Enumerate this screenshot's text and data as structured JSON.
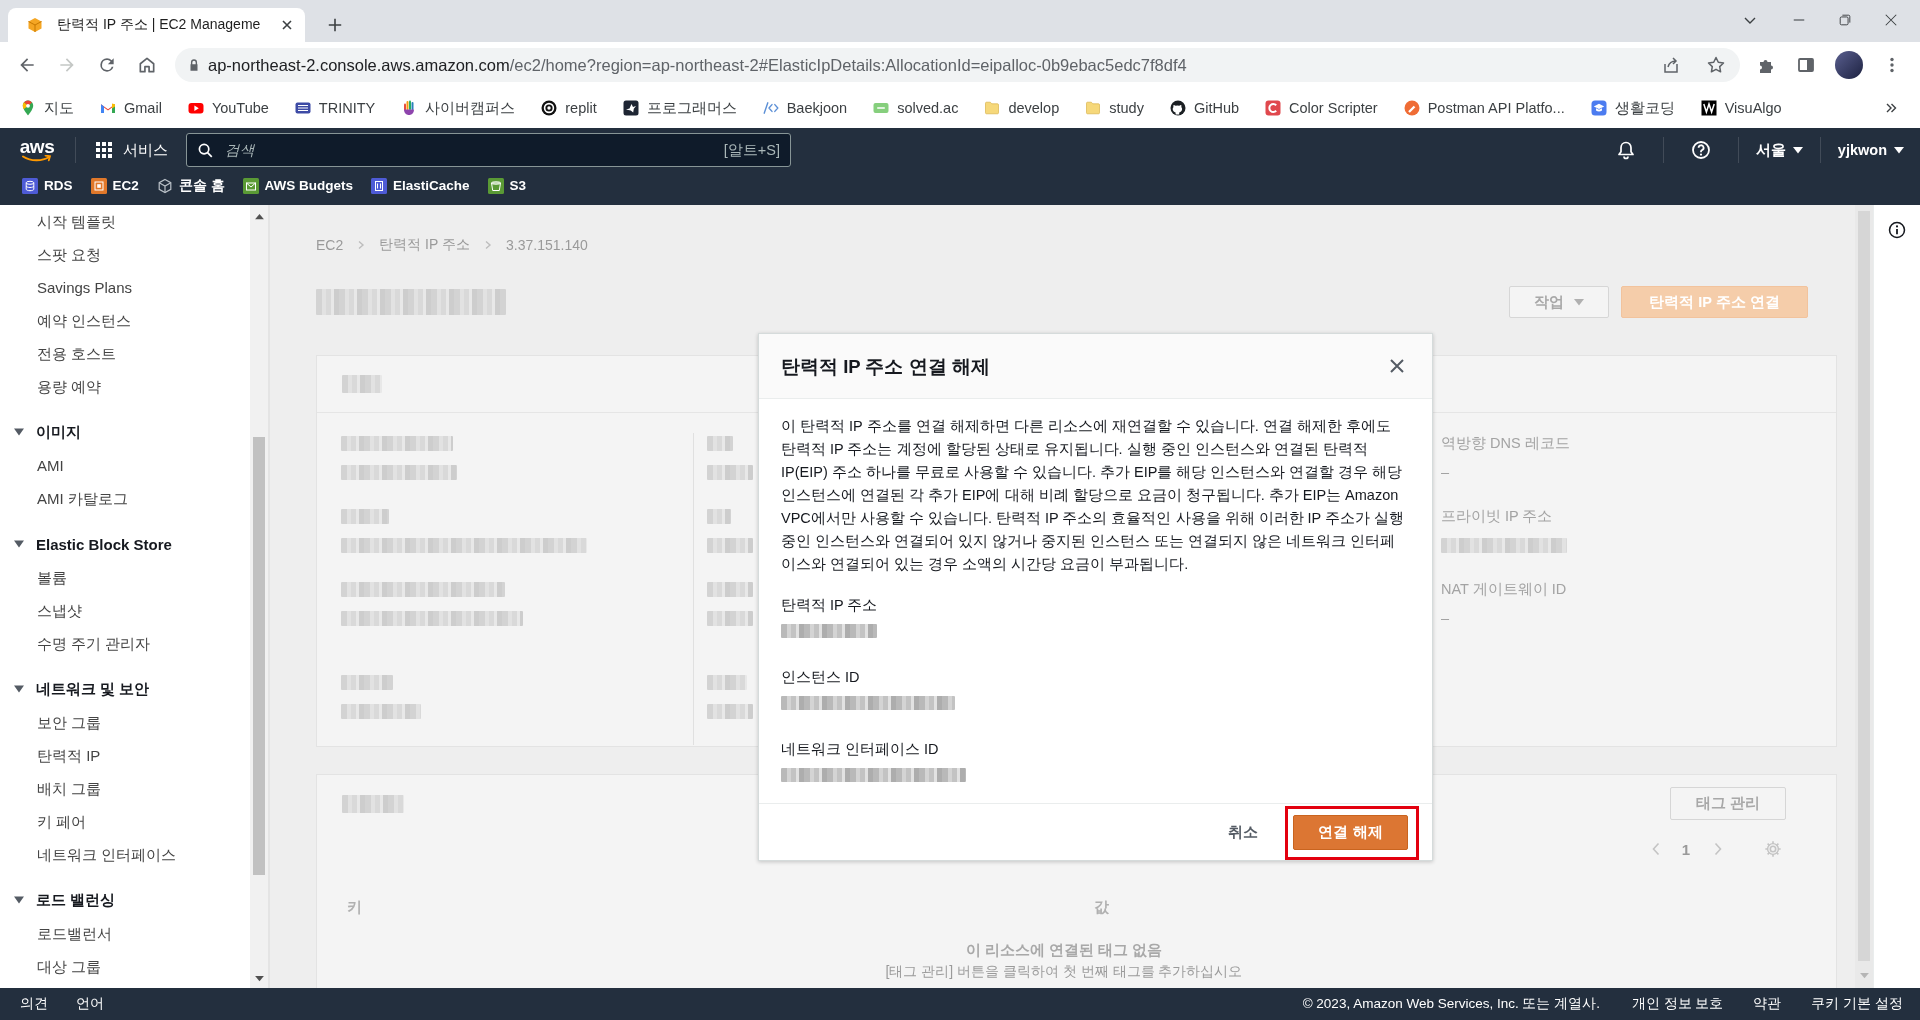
{
  "browser": {
    "tabs": [
      {
        "title": "탄력적 IP 주소 | EC2 Manageme",
        "selected": true
      }
    ],
    "nav_buttons": [
      {
        "kind": "back",
        "disabled": false
      },
      {
        "kind": "forward",
        "disabled": true
      },
      {
        "kind": "reload",
        "disabled": false
      },
      {
        "kind": "home",
        "disabled": false
      }
    ],
    "address": {
      "host": "ap-northeast-2.console.aws.amazon.com",
      "path": "/ec2/home?region=ap-northeast-2#ElasticIpDetails:AllocationId=eipalloc-0b9ebac5edc7f8df4"
    },
    "bookmarks": [
      {
        "label": "지도",
        "kind": "map"
      },
      {
        "label": "Gmail",
        "kind": "mail"
      },
      {
        "label": "YouTube",
        "kind": "video"
      },
      {
        "label": "TRINITY",
        "kind": "building"
      },
      {
        "label": "사이버캠퍼스",
        "kind": "hand"
      },
      {
        "label": "replit",
        "kind": "swirl"
      },
      {
        "label": "프로그래머스",
        "kind": "bird"
      },
      {
        "label": "Baekjoon",
        "kind": "code"
      },
      {
        "label": "solved.ac",
        "kind": "tile"
      },
      {
        "label": "develop",
        "kind": "folder"
      },
      {
        "label": "study",
        "kind": "folder"
      },
      {
        "label": "GitHub",
        "kind": "cat"
      },
      {
        "label": "Color Scripter",
        "kind": "ctile"
      },
      {
        "label": "Postman API Platfo...",
        "kind": "circle"
      },
      {
        "label": "생활코딩",
        "kind": "cap"
      },
      {
        "label": "VisuAlgo",
        "kind": "zigzag"
      }
    ]
  },
  "console_header": {
    "logo": "aws",
    "services": "서비스",
    "search": {
      "placeholder": "검색",
      "shortcut": "[알트+S]"
    },
    "region": "서울",
    "user": "yjkwon",
    "favorites": [
      {
        "label": "RDS",
        "kind": "database"
      },
      {
        "label": "EC2",
        "kind": "chip"
      },
      {
        "label": "콘솔 홈",
        "kind": "cube"
      },
      {
        "label": "AWS Budgets",
        "kind": "envelope"
      },
      {
        "label": "ElastiCache",
        "kind": "memory"
      },
      {
        "label": "S3",
        "kind": "bucket"
      }
    ]
  },
  "sidebar": {
    "items": [
      {
        "label": "시작 템플릿"
      },
      {
        "label": "스팟 요청"
      },
      {
        "label": "Savings Plans"
      },
      {
        "label": "예약 인스턴스"
      },
      {
        "label": "전용 호스트"
      },
      {
        "label": "용량 예약"
      }
    ],
    "sections": [
      {
        "title": "이미지",
        "expanded": true,
        "items": [
          {
            "label": "AMI"
          },
          {
            "label": "AMI 카탈로그"
          }
        ]
      },
      {
        "title": "Elastic Block Store",
        "expanded": true,
        "items": [
          {
            "label": "볼륨"
          },
          {
            "label": "스냅샷"
          },
          {
            "label": "수명 주기 관리자"
          }
        ]
      },
      {
        "title": "네트워크 및 보안",
        "expanded": true,
        "items": [
          {
            "label": "보안 그룹"
          },
          {
            "label": "탄력적 IP"
          },
          {
            "label": "배치 그룹"
          },
          {
            "label": "키 페어"
          },
          {
            "label": "네트워크 인터페이스"
          }
        ]
      },
      {
        "title": "로드 밸런싱",
        "expanded": true,
        "items": [
          {
            "label": "로드밸런서"
          },
          {
            "label": "대상 그룹"
          }
        ]
      }
    ]
  },
  "page": {
    "breadcrumb": [
      "EC2",
      "탄력적 IP 주소",
      "3.37.151.140"
    ],
    "title_pixelated": true,
    "buttons": [
      {
        "label": "작업",
        "kind": "dropdown"
      },
      {
        "label": "탄력적 IP 주소 연결",
        "kind": "primary"
      }
    ],
    "summary": {
      "header_pixelated": true,
      "columns": [
        {
          "fields": [
            {
              "label_pixelated": true,
              "value_pixelated": true
            },
            {
              "label_pixelated": true,
              "value_pixelated": true
            },
            {
              "label_pixelated": true,
              "value_pixelated": true
            },
            {
              "label_pixelated": true,
              "value_pixelated": true
            }
          ]
        },
        {
          "fields": [
            {
              "label_pixelated": true,
              "value_pixelated": true
            },
            {
              "label_pixelated": true,
              "value_pixelated": true
            },
            {
              "label_pixelated": true,
              "value_pixelated": true
            },
            {
              "label_pixelated": true,
              "value_pixelated": true
            }
          ]
        },
        {
          "fields": [
            {
              "label": "역방향 DNS 레코드",
              "value": "–"
            },
            {
              "label": "프라이빗 IP 주소",
              "value_pixelated": true
            },
            {
              "label": "NAT 게이트웨이 ID",
              "value": "–"
            }
          ]
        }
      ]
    },
    "tags": {
      "header_pixelated": true,
      "manage_button": "태그 관리",
      "page_number": "1",
      "columns": [
        "키",
        "값"
      ],
      "empty_title": "이 리소스에 연결된 태그 없음",
      "empty_hint": "[태그 관리] 버튼을 클릭하여 첫 번째 태그를 추가하십시오"
    }
  },
  "modal": {
    "title": "탄력적 IP 주소 연결 해제",
    "body": "이 탄력적 IP 주소를 연결 해제하면 다른 리소스에 재연결할 수 있습니다. 연결 해제한 후에도 탄력적 IP 주소는 계정에 할당된 상태로 유지됩니다. 실행 중인 인스턴스와 연결된 탄력적 IP(EIP) 주소 하나를 무료로 사용할 수 있습니다. 추가 EIP를 해당 인스턴스와 연결할 경우 해당 인스턴스에 연결된 각 추가 EIP에 대해 비례 할당으로 요금이 청구됩니다. 추가 EIP는 Amazon VPC에서만 사용할 수 있습니다. 탄력적 IP 주소의 효율적인 사용을 위해 이러한 IP 주소가 실행 중인 인스턴스와 연결되어 있지 않거나 중지된 인스턴스 또는 연결되지 않은 네트워크 인터페이스와 연결되어 있는 경우 소액의 시간당 요금이 부과됩니다.",
    "fields": [
      {
        "label": "탄력적 IP 주소",
        "value_pixelated": true
      },
      {
        "label": "인스턴스 ID",
        "value_pixelated": true
      },
      {
        "label": "네트워크 인터페이스 ID",
        "value_pixelated": true
      }
    ],
    "buttons": [
      {
        "label": "취소",
        "kind": "link",
        "highlighted": false
      },
      {
        "label": "연결 해제",
        "kind": "primary",
        "highlighted": true
      }
    ]
  },
  "footer": {
    "links_left": [
      "의견",
      "언어"
    ],
    "copyright": "© 2023, Amazon Web Services, Inc. 또는 계열사.",
    "links_right": [
      "개인 정보 보호",
      "약관",
      "쿠키 기본 설정"
    ]
  }
}
